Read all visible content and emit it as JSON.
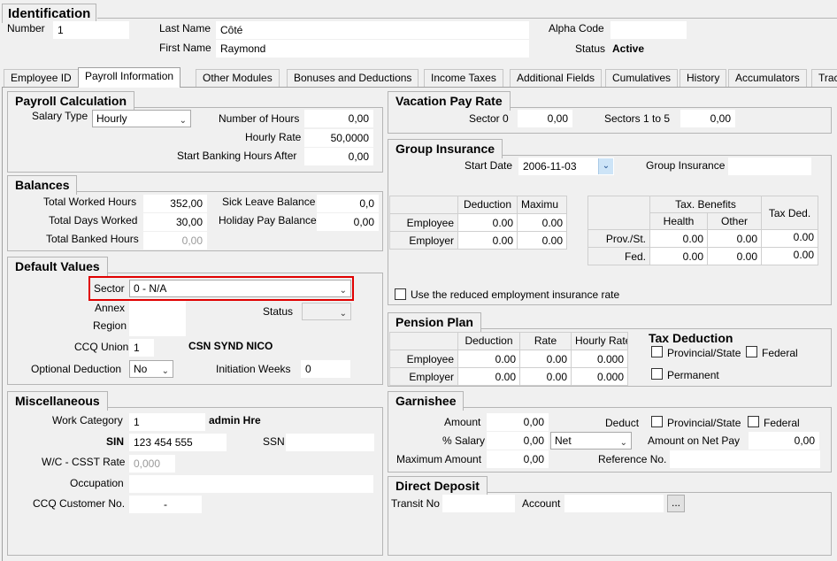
{
  "identification": {
    "title": "Identification",
    "number_label": "Number",
    "number": "1",
    "last_name_label": "Last Name",
    "last_name": "Côté",
    "first_name_label": "First Name",
    "first_name": "Raymond",
    "alpha_code_label": "Alpha Code",
    "alpha_code": "",
    "status_label": "Status",
    "status": "Active"
  },
  "tabs": [
    {
      "label": "Employee ID",
      "active": false
    },
    {
      "label": "Payroll Information",
      "active": true
    },
    {
      "label": "Other Modules",
      "active": false
    },
    {
      "label": "Bonuses and Deductions",
      "active": false
    },
    {
      "label": "Income Taxes",
      "active": false
    },
    {
      "label": "Additional Fields",
      "active": false
    },
    {
      "label": "Cumulatives",
      "active": false
    },
    {
      "label": "History",
      "active": false
    },
    {
      "label": "Accumulators",
      "active": false
    },
    {
      "label": "Trac",
      "active": false
    }
  ],
  "payroll_calc": {
    "title": "Payroll Calculation",
    "salary_type_label": "Salary Type",
    "salary_type": "Hourly",
    "num_hours_label": "Number of Hours",
    "num_hours": "0,00",
    "hourly_rate_label": "Hourly Rate",
    "hourly_rate": "50,0000",
    "start_banking_label": "Start Banking Hours After",
    "start_banking": "0,00"
  },
  "balances": {
    "title": "Balances",
    "worked_hours_label": "Total Worked Hours",
    "worked_hours": "352,00",
    "days_worked_label": "Total Days Worked",
    "days_worked": "30,00",
    "banked_hours_label": "Total Banked Hours",
    "banked_hours": "0,00",
    "sick_leave_label": "Sick Leave Balance",
    "sick_leave": "0,0",
    "holiday_pay_label": "Holiday Pay Balance",
    "holiday_pay": "0,00"
  },
  "defaults": {
    "title": "Default Values",
    "sector_label": "Sector",
    "sector": "0 - N/A",
    "annex_label": "Annex",
    "annex": "",
    "status_label": "Status",
    "status": "",
    "region_label": "Region",
    "region": "",
    "ccq_union_label": "CCQ Union",
    "ccq_union": "1",
    "ccq_union_name": "CSN SYND NICO",
    "optional_deduction_label": "Optional Deduction",
    "optional_deduction": "No",
    "initiation_weeks_label": "Initiation Weeks",
    "initiation_weeks": "0"
  },
  "misc": {
    "title": "Miscellaneous",
    "work_category_label": "Work Category",
    "work_category": "1",
    "work_category_name": "admin Hre",
    "sin_label": "SIN",
    "sin": "123 454 555",
    "ssn_label": "SSN",
    "ssn": "",
    "wc_label": "W/C - CSST Rate",
    "wc": "0,000",
    "occupation_label": "Occupation",
    "occupation": "",
    "ccq_customer_label": "CCQ Customer No.",
    "ccq_customer": "-"
  },
  "vacation": {
    "title": "Vacation Pay Rate",
    "sector0_label": "Sector 0",
    "sector0": "0,00",
    "sectors15_label": "Sectors 1 to 5",
    "sectors15": "0,00"
  },
  "group_ins": {
    "title": "Group Insurance",
    "start_date_label": "Start Date",
    "start_date": "2006-11-03",
    "gi_label": "Group Insurance",
    "gi": "",
    "col_deduction": "Deduction",
    "col_maximum": "Maximu",
    "row_employee": "Employee",
    "row_employer": "Employer",
    "emp_deduction": "0.00",
    "emp_max": "0.00",
    "er_deduction": "0.00",
    "er_max": "0.00",
    "tax_benefits": "Tax. Benefits",
    "health": "Health",
    "other": "Other",
    "tax_ded": "Tax Ded.",
    "prov_label": "Prov./St.",
    "fed_label": "Fed.",
    "prov_health": "0.00",
    "prov_other": "0.00",
    "prov_taxded": "0.00",
    "fed_health": "0.00",
    "fed_other": "0.00",
    "fed_taxded": "0.00",
    "reduced_ei_label": "Use the reduced employment insurance rate"
  },
  "pension": {
    "title": "Pension Plan",
    "col_deduction": "Deduction",
    "col_rate": "Rate",
    "col_hourly": "Hourly Rate",
    "row_employee": "Employee",
    "row_employer": "Employer",
    "emp_deduction": "0.00",
    "emp_rate": "0.00",
    "emp_hourly": "0.000",
    "er_deduction": "0.00",
    "er_rate": "0.00",
    "er_hourly": "0.000",
    "tax_ded_title": "Tax Deduction",
    "prov_label": "Provincial/State",
    "federal_label": "Federal",
    "permanent_label": "Permanent"
  },
  "garnishee": {
    "title": "Garnishee",
    "amount_label": "Amount",
    "amount": "0,00",
    "salary_pct_label": "% Salary",
    "salary_pct": "0,00",
    "net_option": "Net",
    "max_amount_label": "Maximum Amount",
    "max_amount": "0,00",
    "deduct_label": "Deduct",
    "prov_label": "Provincial/State",
    "federal_label": "Federal",
    "net_pay_label": "Amount on Net Pay",
    "net_pay": "0,00",
    "reference_label": "Reference No.",
    "reference": ""
  },
  "deposit": {
    "title": "Direct Deposit",
    "transit_label": "Transit No",
    "transit": "",
    "account_label": "Account",
    "account": "",
    "browse_label": "..."
  },
  "colors": {
    "highlight": "#e00000",
    "dropdown_accent": "#cde4f7"
  }
}
